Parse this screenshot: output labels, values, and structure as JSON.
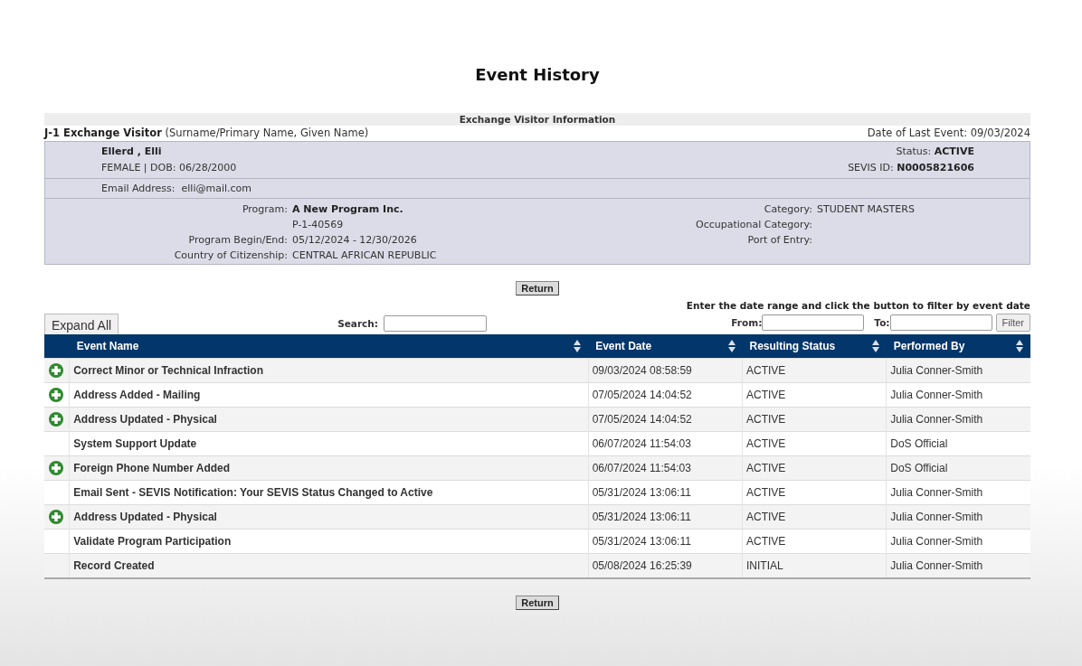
{
  "page_title": "Event History",
  "visitor_info": {
    "heading": "Exchange Visitor Information",
    "type_line": "**J-1 Exchange Visitor** (Surname/Primary Name, Given Name)",
    "last_event": "Date of Last Event: 09/03/2024",
    "name": "Ellerd , Elli",
    "gender_dob": "FEMALE | DOB: 06/28/2000",
    "status": "Status: **ACTIVE**",
    "sevis_id": "SEVIS ID: **N0005821606**",
    "email": "Email Address:  elli@mail.com",
    "left_fields": [
      {
        "label": "Program:",
        "value": "A New Program Inc.",
        "bold": true
      },
      {
        "value": "P-1-40569",
        "bold": false
      },
      {
        "label": "Program Begin/End:",
        "value": "05/12/2024 - 12/30/2026",
        "bold": false
      },
      {
        "label": "Country of Citizenship:",
        "value": "CENTRAL AFRICAN REPUBLIC",
        "bold": false
      }
    ],
    "right_fields": [
      {
        "label": "Category:",
        "value": "STUDENT MASTERS",
        "bold": false
      },
      {
        "label": "Occupational Category:"
      },
      {
        "label": "Port of Entry:"
      }
    ]
  },
  "return_top": "Return",
  "controls": {
    "expand_all": "Expand All",
    "search_label": "Search:",
    "filter_hint": "Enter the date range and click the button to filter by event date",
    "from_label": "From:",
    "to_label": "To:",
    "filter_button": "Filter"
  },
  "table": {
    "columns": [
      {
        "label": "Event Name",
        "sortable": true
      },
      {
        "label": "Event Date",
        "sortable": true
      },
      {
        "label": "Resulting Status",
        "sortable": true
      },
      {
        "label": "Performed By",
        "sortable": true
      }
    ],
    "rows": [
      {
        "expandable": true,
        "event_name": "Correct Minor or Technical Infraction",
        "event_date": "09/03/2024 08:58:59",
        "status": "ACTIVE",
        "performed_by": "Julia Conner-Smith"
      },
      {
        "expandable": true,
        "event_name": "Address Added - Mailing",
        "event_date": "07/05/2024 14:04:52",
        "status": "ACTIVE",
        "performed_by": "Julia Conner-Smith"
      },
      {
        "expandable": true,
        "event_name": "Address Updated - Physical",
        "event_date": "07/05/2024 14:04:52",
        "status": "ACTIVE",
        "performed_by": "Julia Conner-Smith"
      },
      {
        "expandable": false,
        "event_name": "System Support Update",
        "event_date": "06/07/2024 11:54:03",
        "status": "ACTIVE",
        "performed_by": "DoS Official"
      },
      {
        "expandable": true,
        "event_name": "Foreign Phone Number Added",
        "event_date": "06/07/2024 11:54:03",
        "status": "ACTIVE",
        "performed_by": "DoS Official"
      },
      {
        "expandable": false,
        "event_name": "Email Sent - SEVIS Notification: Your SEVIS Status Changed to Active",
        "event_date": "05/31/2024 13:06:11",
        "status": "ACTIVE",
        "performed_by": "Julia Conner-Smith"
      },
      {
        "expandable": true,
        "event_name": "Address Updated - Physical",
        "event_date": "05/31/2024 13:06:11",
        "status": "ACTIVE",
        "performed_by": "Julia Conner-Smith"
      },
      {
        "expandable": false,
        "event_name": "Validate Program Participation",
        "event_date": "05/31/2024 13:06:11",
        "status": "ACTIVE",
        "performed_by": "Julia Conner-Smith"
      },
      {
        "expandable": false,
        "event_name": "Record Created",
        "event_date": "05/08/2024 16:25:39",
        "status": "INITIAL",
        "performed_by": "Julia Conner-Smith"
      }
    ]
  },
  "return_bottom": "Return"
}
